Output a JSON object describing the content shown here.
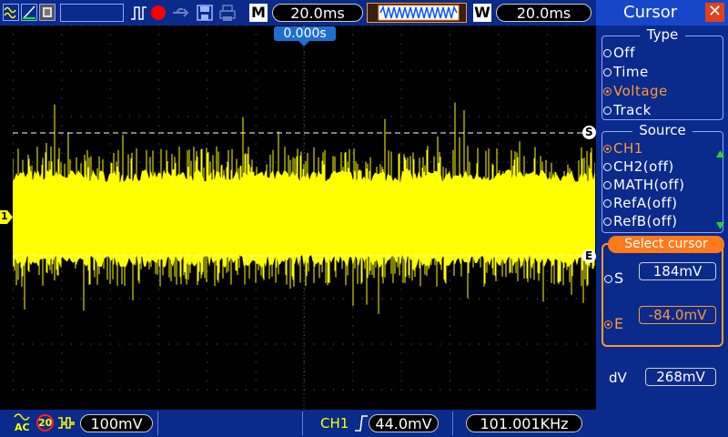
{
  "top": {
    "mem_label": "M",
    "timebase": "20.0ms",
    "win_label": "W",
    "window_timebase": "20.0ms"
  },
  "trigger_position": "0.000s",
  "bottom": {
    "coupling": "AC",
    "bw_limit": "20",
    "volts_div": "100mV",
    "trig_source": "CH1",
    "trig_level": "44.0mV",
    "frequency": "101.001KHz"
  },
  "markers": {
    "channel": "1",
    "cursor_s": "S",
    "cursor_e": "E"
  },
  "panel": {
    "title": "Cursor",
    "type_label": "Type",
    "type_options": [
      "Off",
      "Time",
      "Voltage",
      "Track"
    ],
    "type_selected": "Voltage",
    "source_label": "Source",
    "source_options": [
      "CH1",
      "CH2(off)",
      "MATH(off)",
      "RefA(off)",
      "RefB(off)"
    ],
    "source_selected": "CH1",
    "select_label": "Select cursor",
    "s_label": "S",
    "s_value": "184mV",
    "e_label": "E",
    "e_value": "-84.0mV",
    "dv_label": "dV",
    "dv_value": "268mV"
  },
  "colors": {
    "trace": "#ffff00",
    "accent": "#ff9a2e",
    "bar": "#0a2a8c"
  }
}
